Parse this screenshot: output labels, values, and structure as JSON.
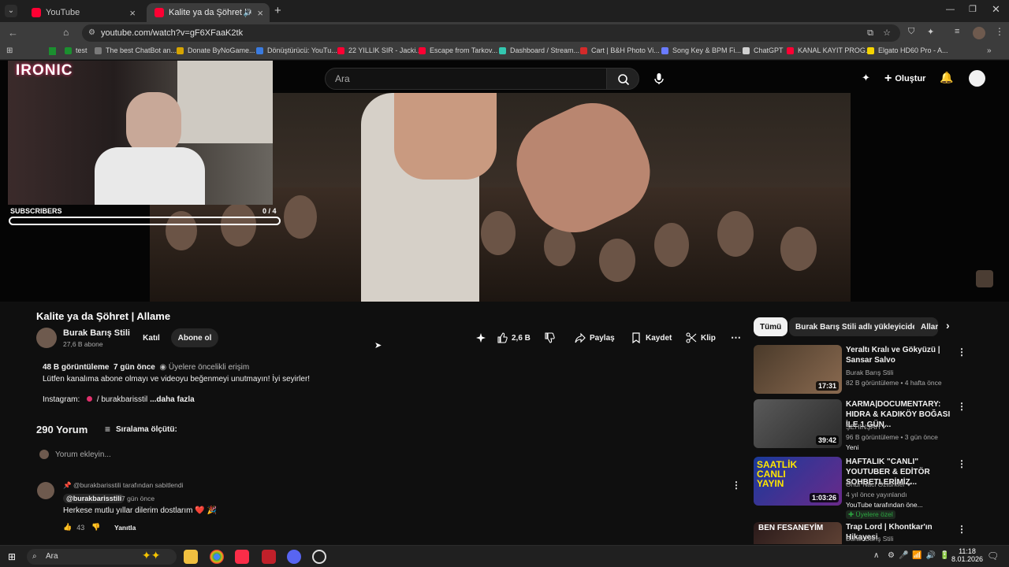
{
  "browser": {
    "tabs": [
      {
        "label": "YouTube"
      },
      {
        "label": "Kalite ya da Şöhret | Allame"
      }
    ],
    "new_tab": "+",
    "url": "youtube.com/watch?v=gF6XFaaK2tk",
    "bookmarks": [
      {
        "label": "test",
        "color": "#1b8f2f"
      },
      {
        "label": "The best ChatBot an...",
        "color": "#7a7a7a"
      },
      {
        "label": "Donate ByNoGame...",
        "color": "#d6a400"
      },
      {
        "label": "Dönüştürücü: YouTu...",
        "color": "#3a7be0"
      },
      {
        "label": "22 YILLIK SIR - Jacki...",
        "color": "#ff0033"
      },
      {
        "label": "Escape from Tarkov...",
        "color": "#ff0033"
      },
      {
        "label": "Dashboard / Stream...",
        "color": "#33c7b0"
      },
      {
        "label": "Cart | B&H Photo Vi...",
        "color": "#d42a2a"
      },
      {
        "label": "Song Key & BPM Fi...",
        "color": "#6a7bff"
      },
      {
        "label": "ChatGPT",
        "color": "#cfcfcf"
      },
      {
        "label": "KANAL KAYIT PROG...",
        "color": "#ff0033"
      },
      {
        "label": "Elgato HD60 Pro - A...",
        "color": "#f5d400"
      }
    ]
  },
  "overlay": {
    "logo_text": "IRONIC",
    "sub_label": "SUBSCRIBERS",
    "sub_count": "0 / 4",
    "sub_progress": 0
  },
  "header": {
    "search_placeholder": "Ara",
    "create_label": "Oluştur"
  },
  "video": {
    "title": "Kalite ya da Şöhret | Allame",
    "channel": "Burak Barış Stili",
    "subscribers": "27,6 B abone",
    "join": "Katıl",
    "subscribe": "Abone ol",
    "likes": "2,6 B",
    "share": "Paylaş",
    "save": "Kaydet",
    "clip": "Klip"
  },
  "description": {
    "views": "48 B görüntüleme",
    "date": "7 gün önce",
    "members": "Üyelere öncelikli erişim",
    "line1": "Lütfen kanalıma abone olmayı ve videoyu beğenmeyi unutmayın! İyi seyirler!",
    "instagram_label": "Instagram:",
    "instagram_handle": "/ burakbarisstil",
    "more": "...daha fazla"
  },
  "comments": {
    "count": "290 Yorum",
    "sort": "Sıralama ölçütü:",
    "add_placeholder": "Yorum ekleyin...",
    "pinned_by": "@burakbarisstili tarafından sabitlendi",
    "author": "@burakbarisstili",
    "age": "7 gün önce",
    "text": "Herkese mutlu yıllar dilerim dostlarım ❤️ 🎉",
    "likes": "43",
    "reply": "Yanıtla"
  },
  "chips": [
    {
      "label": "Tümü"
    },
    {
      "label": "Burak Barış Stili adlı yükleyiciden"
    },
    {
      "label": "Allam"
    }
  ],
  "recommendations": [
    {
      "title": "Yeraltı Kralı ve Gökyüzü | Sansar Salvo",
      "channel": "Burak Barış Stili",
      "meta": "82 B görüntüleme • 4 hafta önce",
      "duration": "17:31",
      "extra": ""
    },
    {
      "title": "KARMA|DOCUMENTARY: HIDRA & KADIKÖY BOĞASI İLE 1 GÜN...",
      "channel": "ŞEHİNŞAH",
      "meta": "96 B görüntüleme • 3 gün önce",
      "duration": "39:42",
      "extra": "Yeni"
    },
    {
      "title": "HAFTALIK \"CANLI\" YOUTUBER & EDİTÖR SOHBETLERİMİZ...",
      "channel": "Onur Naci Öztürkler",
      "meta": "4 yıl önce yayınlandı",
      "duration": "1:03:26",
      "extra": "YouTube tarafından öne...",
      "badge": "Üyelere özel",
      "thumb_text": "SAATLİK CANLI YAYIN"
    },
    {
      "title": "Trap Lord | Khontkar'ın Hikayesi",
      "channel": "Burak Barış Stili",
      "meta": "",
      "duration": "",
      "extra": "",
      "thumb_text": "BEN FESANEYİM"
    }
  ],
  "taskbar": {
    "search": "Ara",
    "time": "11:18",
    "date": "8.01.2026"
  }
}
